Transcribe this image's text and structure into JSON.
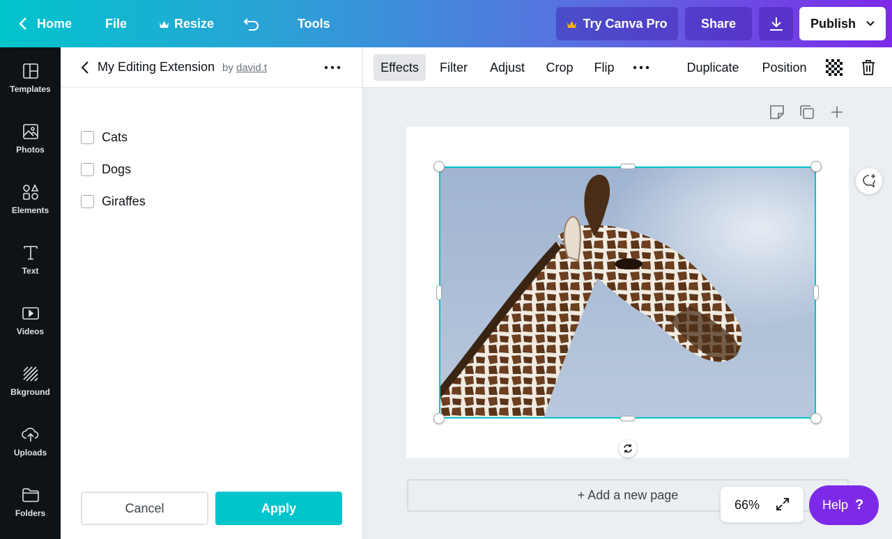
{
  "topbar": {
    "home": "Home",
    "file": "File",
    "resize": "Resize",
    "tools": "Tools",
    "try_pro": "Try Canva Pro",
    "share": "Share",
    "publish": "Publish",
    "gradient_start": "#00c4cc",
    "gradient_end": "#7d2ae8"
  },
  "rail": {
    "items": [
      {
        "label": "Templates",
        "icon": "templates-icon"
      },
      {
        "label": "Photos",
        "icon": "photos-icon"
      },
      {
        "label": "Elements",
        "icon": "elements-icon"
      },
      {
        "label": "Text",
        "icon": "text-icon"
      },
      {
        "label": "Videos",
        "icon": "videos-icon"
      },
      {
        "label": "Bkground",
        "icon": "background-icon"
      },
      {
        "label": "Uploads",
        "icon": "uploads-icon"
      },
      {
        "label": "Folders",
        "icon": "folders-icon"
      }
    ]
  },
  "panel": {
    "title": "My Editing Extension",
    "by": "by",
    "author": "david.t",
    "options": [
      {
        "label": "Cats",
        "checked": false
      },
      {
        "label": "Dogs",
        "checked": false
      },
      {
        "label": "Giraffes",
        "checked": false
      }
    ],
    "cancel": "Cancel",
    "apply": "Apply",
    "accent": "#00c4cc"
  },
  "toolbar": {
    "effects": "Effects",
    "filter": "Filter",
    "adjust": "Adjust",
    "crop": "Crop",
    "flip": "Flip",
    "duplicate": "Duplicate",
    "position": "Position"
  },
  "canvas": {
    "add_page": "+ Add a new page",
    "zoom": "66%",
    "help": "Help",
    "help_mark": "?",
    "selection_color": "#00c4cc",
    "photo_subject": "giraffe-photo"
  }
}
